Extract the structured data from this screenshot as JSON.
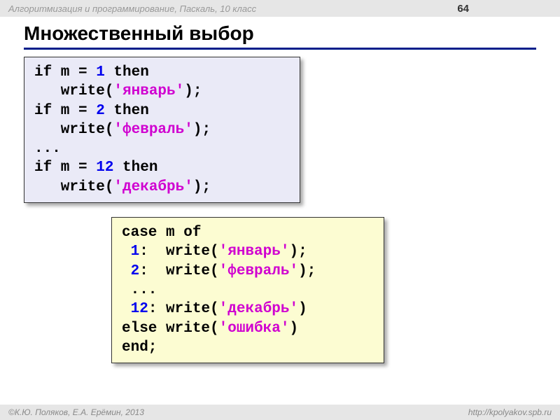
{
  "header": {
    "course_title": "Алгоритмизация и программирование, Паскаль, 10 класс",
    "page_number": "64"
  },
  "slide_title": "Множественный выбор",
  "code_block_1": {
    "lines": [
      {
        "tokens": [
          {
            "t": "if m = ",
            "c": "kw"
          },
          {
            "t": "1",
            "c": "num"
          },
          {
            "t": " then",
            "c": "kw"
          }
        ]
      },
      {
        "tokens": [
          {
            "t": "   write(",
            "c": "kw"
          },
          {
            "t": "'январь'",
            "c": "str"
          },
          {
            "t": ");",
            "c": "kw"
          }
        ]
      },
      {
        "tokens": [
          {
            "t": "if m = ",
            "c": "kw"
          },
          {
            "t": "2",
            "c": "num"
          },
          {
            "t": " then",
            "c": "kw"
          }
        ]
      },
      {
        "tokens": [
          {
            "t": "   write(",
            "c": "kw"
          },
          {
            "t": "'февраль'",
            "c": "str"
          },
          {
            "t": ");",
            "c": "kw"
          }
        ]
      },
      {
        "tokens": [
          {
            "t": "...",
            "c": "kw"
          }
        ]
      },
      {
        "tokens": [
          {
            "t": "if m = ",
            "c": "kw"
          },
          {
            "t": "12",
            "c": "num"
          },
          {
            "t": " then",
            "c": "kw"
          }
        ]
      },
      {
        "tokens": [
          {
            "t": "   write(",
            "c": "kw"
          },
          {
            "t": "'декабрь'",
            "c": "str"
          },
          {
            "t": ");",
            "c": "kw"
          }
        ]
      }
    ]
  },
  "code_block_2": {
    "lines": [
      {
        "tokens": [
          {
            "t": "case m of",
            "c": "kw"
          }
        ]
      },
      {
        "tokens": [
          {
            "t": " ",
            "c": "kw"
          },
          {
            "t": "1",
            "c": "num"
          },
          {
            "t": ":  write(",
            "c": "kw"
          },
          {
            "t": "'январь'",
            "c": "str"
          },
          {
            "t": ");",
            "c": "kw"
          }
        ]
      },
      {
        "tokens": [
          {
            "t": " ",
            "c": "kw"
          },
          {
            "t": "2",
            "c": "num"
          },
          {
            "t": ":  write(",
            "c": "kw"
          },
          {
            "t": "'февраль'",
            "c": "str"
          },
          {
            "t": ");",
            "c": "kw"
          }
        ]
      },
      {
        "tokens": [
          {
            "t": " ...",
            "c": "kw"
          }
        ]
      },
      {
        "tokens": [
          {
            "t": " ",
            "c": "kw"
          },
          {
            "t": "12",
            "c": "num"
          },
          {
            "t": ": write(",
            "c": "kw"
          },
          {
            "t": "'декабрь'",
            "c": "str"
          },
          {
            "t": ")",
            "c": "kw"
          }
        ]
      },
      {
        "tokens": [
          {
            "t": "else write(",
            "c": "kw"
          },
          {
            "t": "'ошибка'",
            "c": "str"
          },
          {
            "t": ")",
            "c": "kw"
          }
        ]
      },
      {
        "tokens": [
          {
            "t": "end;",
            "c": "kw"
          }
        ]
      }
    ]
  },
  "footer": {
    "authors": "К.Ю. Поляков, Е.А. Ерёмин, 2013",
    "url": "http://kpolyakov.spb.ru"
  }
}
